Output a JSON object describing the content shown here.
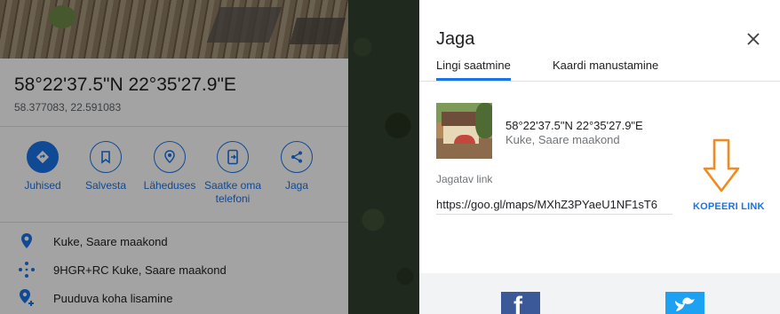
{
  "place": {
    "title": "58°22'37.5\"N 22°35'27.9\"E",
    "coords": "58.377083, 22.591083",
    "actions": [
      {
        "label": "Juhised",
        "icon": "directions-icon"
      },
      {
        "label": "Salvesta",
        "icon": "bookmark-icon"
      },
      {
        "label": "Läheduses",
        "icon": "nearby-icon"
      },
      {
        "label": "Saatke oma telefoni",
        "icon": "send-to-phone-icon"
      },
      {
        "label": "Jaga",
        "icon": "share-icon"
      }
    ],
    "info": [
      {
        "text": "Kuke, Saare maakond",
        "icon": "location-pin-icon"
      },
      {
        "text": "9HGR+RC Kuke, Saare maakond",
        "icon": "plus-code-icon"
      },
      {
        "text": "Puuduva koha lisamine",
        "icon": "add-place-icon"
      }
    ]
  },
  "dialog": {
    "title": "Jaga",
    "tabs": [
      "Lingi saatmine",
      "Kaardi manustamine"
    ],
    "active_tab": "Lingi saatmine",
    "summary_title": "58°22'37.5\"N 22°35'27.9\"E",
    "summary_subtitle": "Kuke, Saare maakond",
    "link_label": "Jagatav link",
    "link_value": "https://goo.gl/maps/MXhZ3PYaeU1NF1sT6",
    "copy_label": "KOPEERI LINK",
    "social": [
      "facebook-icon",
      "twitter-icon"
    ]
  },
  "colors": {
    "accent": "#1a73e8",
    "annotation_arrow": "#ef8b1f",
    "facebook": "#3b5998",
    "twitter": "#1da1f2"
  }
}
